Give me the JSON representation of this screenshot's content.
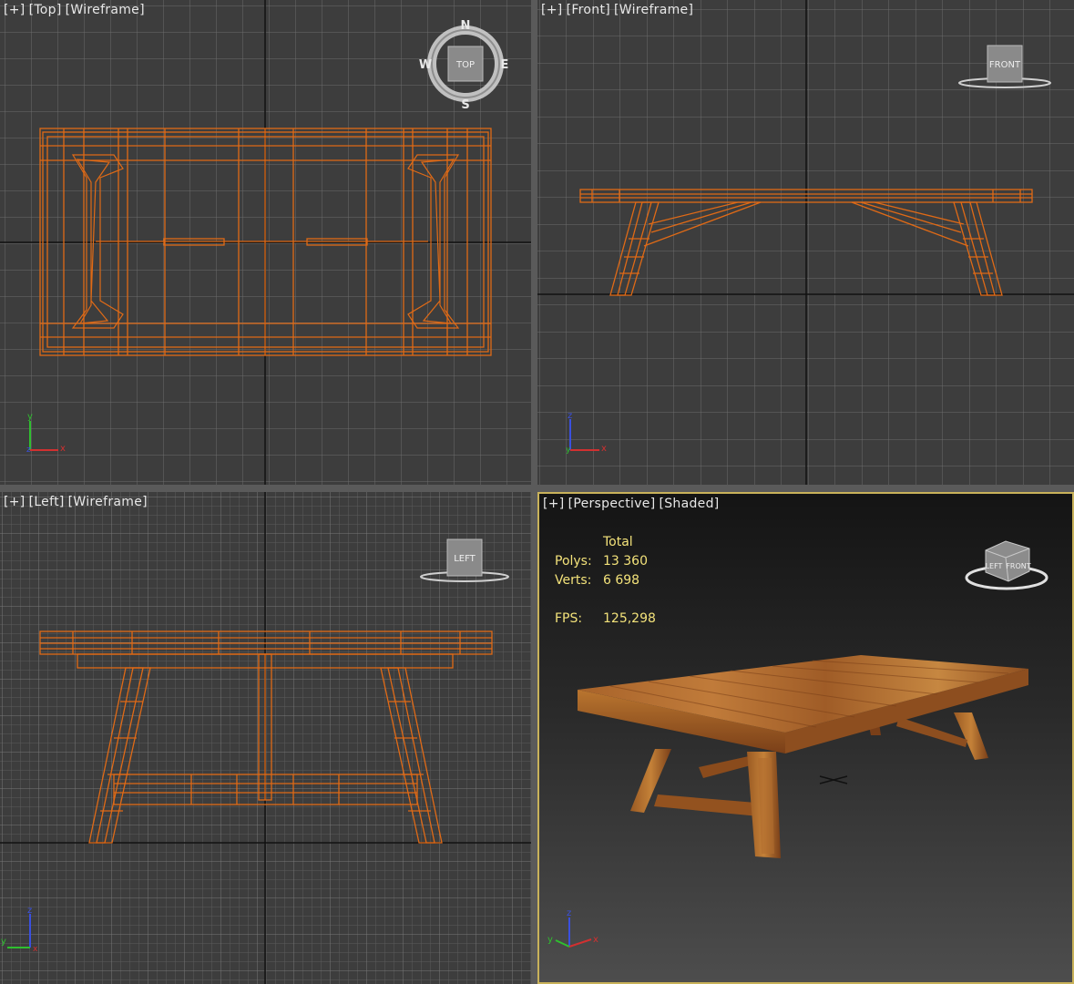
{
  "viewports": {
    "top": {
      "plus": "[+]",
      "view": "[Top]",
      "mode": "[Wireframe]",
      "cube_label": "TOP",
      "compass": {
        "n": "N",
        "s": "S",
        "e": "E",
        "w": "W"
      }
    },
    "front": {
      "plus": "[+]",
      "view": "[Front]",
      "mode": "[Wireframe]",
      "cube_label": "FRONT"
    },
    "left": {
      "plus": "[+]",
      "view": "[Left]",
      "mode": "[Wireframe]",
      "cube_label": "LEFT"
    },
    "perspective": {
      "plus": "[+]",
      "view": "[Perspective]",
      "mode": "[Shaded]",
      "cube_label_left": "LEFT",
      "cube_label_right": "FRONT"
    }
  },
  "stats": {
    "header": "Total",
    "polys_label": "Polys:",
    "polys": "13 360",
    "verts_label": "Verts:",
    "verts": "6 698",
    "fps_label": "FPS:",
    "fps": "125,298"
  },
  "axes": {
    "x": "x",
    "y": "y",
    "z": "z"
  },
  "colors": {
    "wire": "#e06a16",
    "grid": "#6a6a6a",
    "active_border": "#c9b25a",
    "stats_text": "#f3e27a",
    "axis_x": "#d23030",
    "axis_y": "#2fbf2f",
    "axis_z": "#3a50e0"
  }
}
